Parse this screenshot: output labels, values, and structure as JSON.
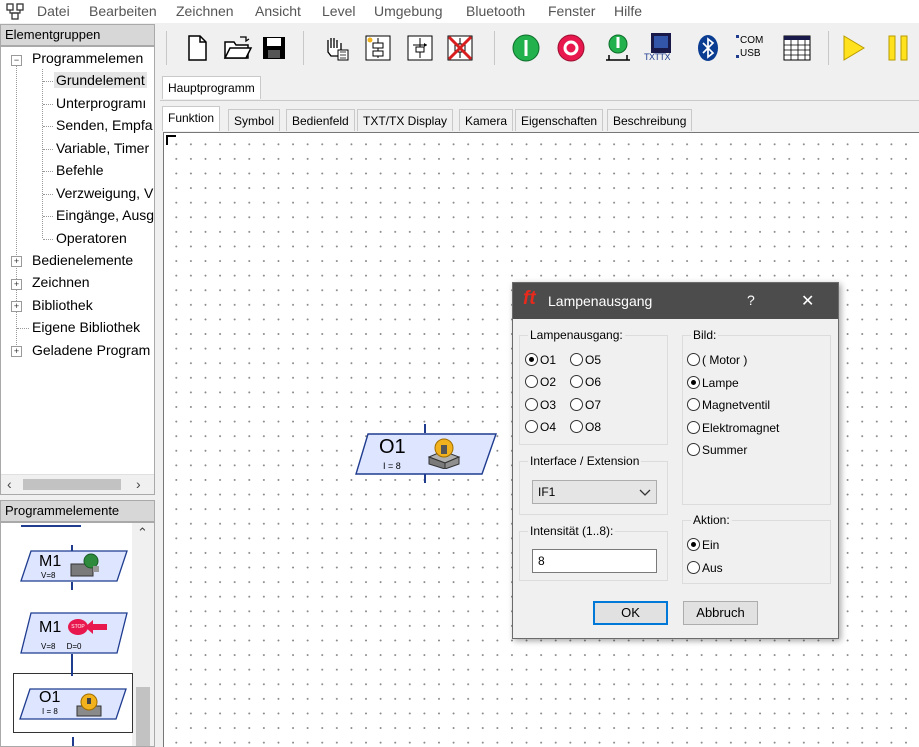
{
  "menu": [
    "Datei",
    "Bearbeiten",
    "Zeichnen",
    "Ansicht",
    "Level",
    "Umgebung",
    "Bluetooth",
    "Fenster",
    "Hilfe"
  ],
  "elementgruppen": {
    "title": "Elementgruppen",
    "root": "Programmelemen",
    "children": [
      "Grundelement",
      "Unterprogramı",
      "Senden, Empfa",
      "Variable, Timer",
      "Befehle",
      "Verzweigung, V",
      "Eingänge, Ausg",
      "Operatoren"
    ],
    "others": [
      "Bedienelemente",
      "Zeichnen",
      "Bibliothek",
      "Eigene Bibliothek",
      "Geladene Program"
    ]
  },
  "programmelemente": {
    "title": "Programmelemente",
    "items": [
      {
        "name": "M1",
        "sub": "V=8"
      },
      {
        "name": "M1",
        "sub": "V=8     D=0",
        "badge": "STOP"
      },
      {
        "name": "O1",
        "sub": "I = 8"
      }
    ]
  },
  "toolbar": {
    "com": "COM",
    "usb": "USB",
    "txt": "TXTTX"
  },
  "program_tab": "Hauptprogramm",
  "tabs": [
    "Funktion",
    "Symbol",
    "Bedienfeld",
    "TXT/TX Display",
    "Kamera",
    "Eigenschaften",
    "Beschreibung"
  ],
  "canvas_block": {
    "name": "O1",
    "sub": "I = 8"
  },
  "dialog": {
    "logo": "ft",
    "title": "Lampenausgang",
    "help": "?",
    "close": "✕",
    "outputs_label": "Lampenausgang:",
    "outputs": [
      "O1",
      "O5",
      "O2",
      "O6",
      "O3",
      "O7",
      "O4",
      "O8"
    ],
    "selected_output": "O1",
    "image_label": "Bild:",
    "images": [
      "( Motor )",
      "Lampe",
      "Magnetventil",
      "Elektromagnet",
      "Summer"
    ],
    "selected_image": "Lampe",
    "interface_label": "Interface / Extension",
    "interface_value": "IF1",
    "intensity_label": "Intensität (1..8):",
    "intensity_value": "8",
    "action_label": "Aktion:",
    "actions": [
      "Ein",
      "Aus"
    ],
    "selected_action": "Ein",
    "ok": "OK",
    "cancel": "Abbruch"
  },
  "colors": {
    "accent": "#0078d7",
    "dialog_title": "#4c4c4c",
    "logo": "#e8291c",
    "block_border": "#1f3c8f"
  }
}
